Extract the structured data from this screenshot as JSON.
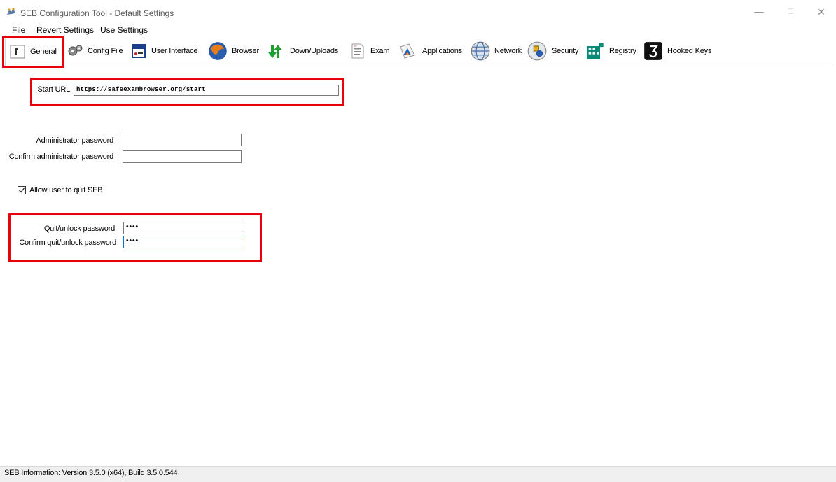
{
  "window": {
    "title": "SEB Configuration Tool - Default Settings",
    "controls": {
      "minimize": "—",
      "maximize": "☐",
      "close": "✕"
    }
  },
  "menu": [
    "File",
    "Revert Settings",
    "Use Settings"
  ],
  "tabs": [
    {
      "label": "General",
      "icon": "general-icon",
      "active": true
    },
    {
      "label": "Config File",
      "icon": "config-file-icon"
    },
    {
      "label": "User Interface",
      "icon": "user-interface-icon"
    },
    {
      "label": "Browser",
      "icon": "browser-icon"
    },
    {
      "label": "Down/Uploads",
      "icon": "down-uploads-icon"
    },
    {
      "label": "Exam",
      "icon": "exam-icon"
    },
    {
      "label": "Applications",
      "icon": "applications-icon"
    },
    {
      "label": "Network",
      "icon": "network-icon"
    },
    {
      "label": "Security",
      "icon": "security-icon"
    },
    {
      "label": "Registry",
      "icon": "registry-icon"
    },
    {
      "label": "Hooked Keys",
      "icon": "hooked-keys-icon"
    }
  ],
  "general": {
    "start_url_label": "Start URL",
    "start_url_value": "https://safeexambrowser.org/start",
    "admin_password_label": "Administrator password",
    "admin_password_value": "",
    "confirm_admin_password_label": "Confirm administrator password",
    "confirm_admin_password_value": "",
    "allow_quit_label": "Allow user to quit SEB",
    "allow_quit_checked": true,
    "quit_password_label": "Quit/unlock password",
    "quit_password_value": "••••",
    "confirm_quit_password_label": "Confirm quit/unlock password",
    "confirm_quit_password_value": "••••"
  },
  "status": "SEB Information: Version 3.5.0 (x64), Build 3.5.0.544",
  "colors": {
    "highlight": "#e8000c",
    "focus": "#0078d7"
  }
}
